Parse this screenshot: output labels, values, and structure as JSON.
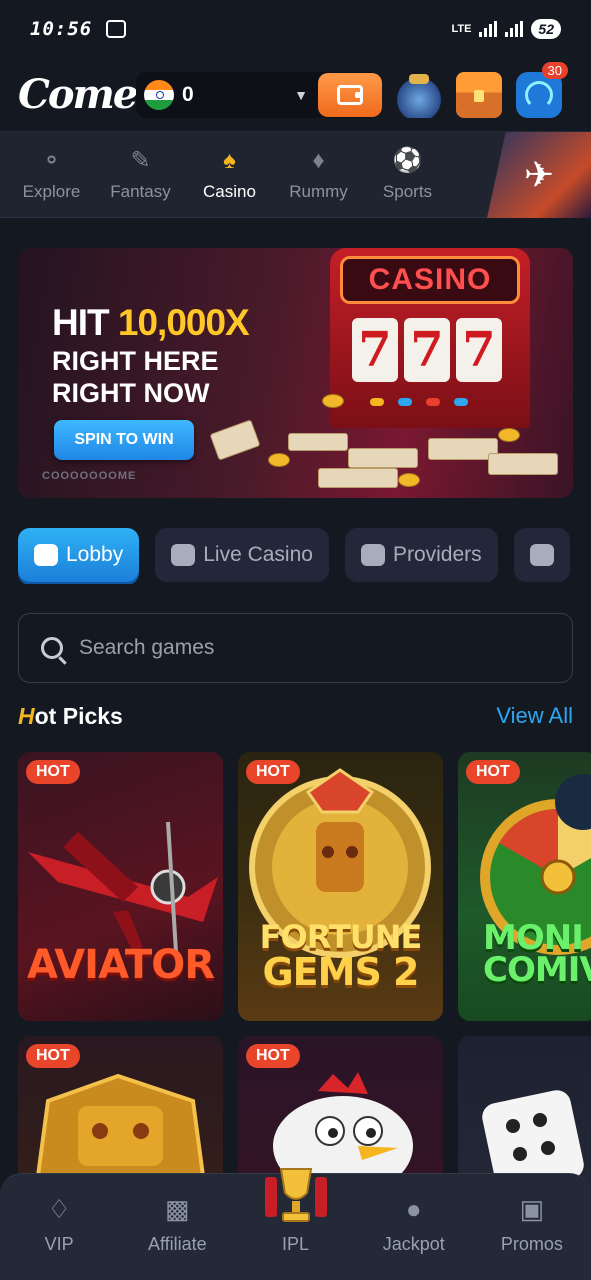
{
  "status_bar": {
    "time": "10:56",
    "network": "LTE",
    "battery": "52"
  },
  "header": {
    "logo": "Come",
    "balance": "0",
    "notification_count": "30",
    "icons": [
      "piggy-jar-icon",
      "treasure-chest-icon",
      "support-icon"
    ]
  },
  "categories": [
    {
      "label": "Explore",
      "icon": "planet-icon",
      "active": false
    },
    {
      "label": "Fantasy",
      "icon": "cricket-bat-icon",
      "active": false
    },
    {
      "label": "Casino",
      "icon": "spade-icon",
      "active": true
    },
    {
      "label": "Rummy",
      "icon": "cards-icon",
      "active": false
    },
    {
      "label": "Sports",
      "icon": "soccer-ball-icon",
      "active": false
    }
  ],
  "banner": {
    "hit": "HIT",
    "amount": "10,000X",
    "line1": "RIGHT HERE",
    "line2": "RIGHT NOW",
    "button": "SPIN TO WIN",
    "pager": "COOOOOOOME",
    "sign": "CASINO",
    "reels": [
      "7",
      "7",
      "7"
    ]
  },
  "tabs": [
    {
      "label": "Lobby",
      "icon": "gamepad-icon",
      "active": true
    },
    {
      "label": "Live Casino",
      "icon": "play-icon",
      "active": false
    },
    {
      "label": "Providers",
      "icon": "provider-icon",
      "active": false
    },
    {
      "label": "",
      "icon": "slot-machine-icon",
      "active": false
    }
  ],
  "search": {
    "placeholder": "Search games"
  },
  "hot_picks": {
    "title_first": "H",
    "title_rest": "ot Picks",
    "view_all": "View All",
    "badge": "HOT",
    "games": [
      {
        "title": "AVIATOR",
        "hot": true
      },
      {
        "title_line1": "FORTUNE",
        "title_line2": "GEMS 2",
        "hot": true
      },
      {
        "title_line1": "MONI",
        "title_line2": "COMIV",
        "hot": true
      },
      {
        "title": "",
        "hot": true
      },
      {
        "title": "",
        "hot": true
      },
      {
        "title": "",
        "hot": false
      }
    ]
  },
  "bottom_nav": [
    {
      "label": "VIP",
      "icon": "diamond-icon"
    },
    {
      "label": "Affiliate",
      "icon": "briefcase-icon"
    },
    {
      "label": "IPL",
      "icon": "trophy-icon"
    },
    {
      "label": "Jackpot",
      "icon": "jackpot-icon"
    },
    {
      "label": "Promos",
      "icon": "gift-icon"
    }
  ],
  "colors": {
    "accent": "#2ea7f0",
    "gold": "#f5b51f",
    "hot": "#e8452a",
    "background": "#141821"
  }
}
